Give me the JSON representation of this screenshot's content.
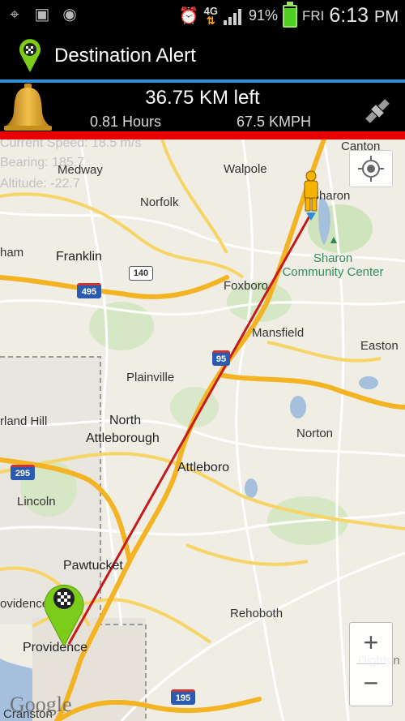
{
  "status_bar": {
    "battery_percent": "91%",
    "day": "FRI",
    "time": "6:13",
    "meridiem": "PM",
    "network": "4G",
    "battery_level": 0.91
  },
  "app_bar": {
    "title": "Destination Alert"
  },
  "info_panel": {
    "distance_left": "36.75 KM left",
    "hours": "0.81 Hours",
    "speed": "67.5 KMPH"
  },
  "overlay": {
    "current_speed": "Current Speed: 18.5 m/s",
    "bearing": "Bearing: 185.7",
    "altitude": "Altitude: -22.7"
  },
  "map": {
    "places": {
      "canton": "Canton",
      "medway": "Medway",
      "walpole": "Walpole",
      "sharon": "Sharon",
      "norfolk": "Norfolk",
      "ham": "ham",
      "franklin": "Franklin",
      "sharon_community_center_1": "Sharon",
      "sharon_community_center_2": "Community Center",
      "foxboro": "Foxboro",
      "mansfield": "Mansfield",
      "easton": "Easton",
      "plainville": "Plainville",
      "north": "North",
      "attleborough": "Attleborough",
      "rland_hill": "rland Hill",
      "norton": "Norton",
      "attleboro": "Attleboro",
      "lincoln": "Lincoln",
      "pawtucket": "Pawtucket",
      "ovidence": "ovidence",
      "rehoboth": "Rehoboth",
      "providence": "Providence",
      "dighton": "Dighton",
      "cranston": "Cranston"
    },
    "shields": {
      "r140": "140",
      "i495": "495",
      "i95": "95",
      "i295": "295",
      "i195": "195"
    },
    "google": "Google",
    "zoom_in": "+",
    "zoom_out": "−"
  }
}
